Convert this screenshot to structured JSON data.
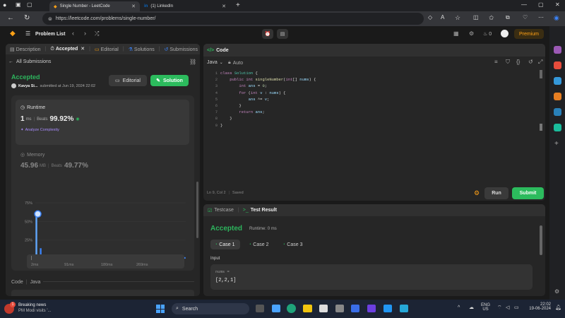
{
  "browser": {
    "tabs": [
      {
        "title": "Single Number - LeetCode"
      },
      {
        "title": "(1) LinkedIn"
      }
    ],
    "url": "https://leetcode.com/problems/single-number/"
  },
  "lc_nav": {
    "problem_list": "Problem List",
    "fire_count": "0",
    "premium": "Premium"
  },
  "left": {
    "tabs": [
      "Description",
      "Accepted",
      "Editorial",
      "Solutions",
      "Submissions"
    ],
    "all_submissions": "All Submissions",
    "status": "Accepted",
    "user": "Kavya Si...",
    "submitted": "submitted at Jun 19, 2024 22:02",
    "editorial_btn": "Editorial",
    "solution_btn": "Solution",
    "runtime_label": "Runtime",
    "runtime_value": "1",
    "runtime_unit": "ms",
    "beats_label": "Beats",
    "runtime_beats": "99.92%",
    "analyze": "Analyze Complexity",
    "memory_label": "Memory",
    "memory_value": "45.96",
    "memory_unit": "MB",
    "memory_beats": "49.77%",
    "code_label": "Code",
    "lang_label": "Java"
  },
  "chart_data": {
    "type": "bar",
    "y_ticks": [
      "75%",
      "50%",
      "25%",
      "0%"
    ],
    "x_ticks": [
      "2ms",
      "91ms",
      "180ms",
      "269ms"
    ],
    "mini_x_ticks": [
      "2ms",
      "91ms",
      "180ms",
      "269ms"
    ],
    "ylim": [
      0,
      75
    ],
    "values": [
      60,
      2,
      14,
      3,
      2,
      2,
      2,
      2,
      2,
      2,
      2,
      2,
      2,
      2,
      2,
      2,
      2,
      2,
      2,
      2,
      2,
      2,
      2,
      2,
      2,
      2,
      2,
      2,
      2,
      2,
      2,
      2,
      2,
      2,
      2,
      2,
      2,
      2,
      2,
      2,
      2,
      2,
      2,
      2,
      2,
      2,
      2,
      2,
      2,
      2,
      2,
      2,
      2,
      2,
      2,
      2,
      2,
      2,
      2,
      2,
      2,
      2,
      2,
      2,
      2,
      2,
      2,
      2,
      2,
      2
    ],
    "highlight_index": 0,
    "color": "#3b82f6"
  },
  "editor": {
    "title": "Code",
    "lang": "Java",
    "auto": "Auto",
    "lines": [
      "class Solution {",
      "    public int singleNumber(int[] nums) {",
      "        int ans = 0;",
      "        for (int v : nums) {",
      "            ans ^= v;",
      "        }",
      "        return ans;",
      "    }",
      "}"
    ],
    "status_pos": "Ln 9, Col 2",
    "status_saved": "Saved",
    "run": "Run",
    "submit": "Submit"
  },
  "testpanel": {
    "tab_testcase": "Testcase",
    "tab_result": "Test Result",
    "result": "Accepted",
    "runtime": "Runtime: 0 ms",
    "cases": [
      "Case 1",
      "Case 2",
      "Case 3"
    ],
    "input_label": "Input",
    "var_name": "nums =",
    "var_value": "[2,2,1]"
  },
  "taskbar": {
    "news_title": "Breaking news",
    "news_sub": "PM Modi visits '...",
    "search": "Search",
    "lang1": "ENG",
    "lang2": "US",
    "time": "22:02",
    "date": "19-06-2024",
    "notif_count": "1"
  },
  "colors": {
    "accent_green": "#2cbb5d",
    "accepted": "#2db55d",
    "premium": "#ffa116",
    "bar": "#3b82f6"
  }
}
